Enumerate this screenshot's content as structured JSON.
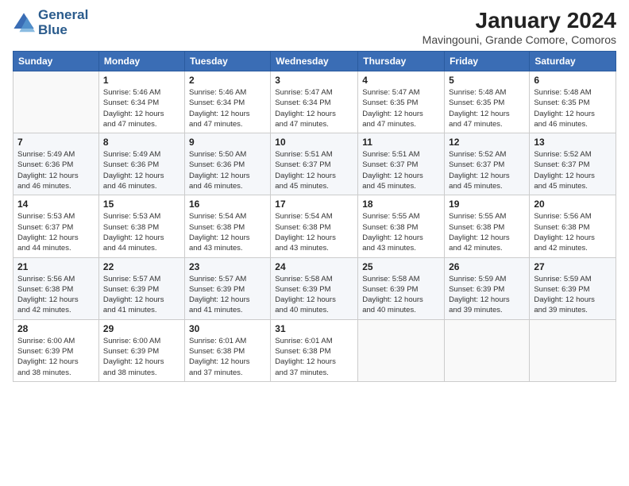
{
  "header": {
    "logo_line1": "General",
    "logo_line2": "Blue",
    "main_title": "January 2024",
    "subtitle": "Mavingouni, Grande Comore, Comoros"
  },
  "calendar": {
    "days_of_week": [
      "Sunday",
      "Monday",
      "Tuesday",
      "Wednesday",
      "Thursday",
      "Friday",
      "Saturday"
    ],
    "weeks": [
      [
        {
          "day": "",
          "info": ""
        },
        {
          "day": "1",
          "info": "Sunrise: 5:46 AM\nSunset: 6:34 PM\nDaylight: 12 hours\nand 47 minutes."
        },
        {
          "day": "2",
          "info": "Sunrise: 5:46 AM\nSunset: 6:34 PM\nDaylight: 12 hours\nand 47 minutes."
        },
        {
          "day": "3",
          "info": "Sunrise: 5:47 AM\nSunset: 6:34 PM\nDaylight: 12 hours\nand 47 minutes."
        },
        {
          "day": "4",
          "info": "Sunrise: 5:47 AM\nSunset: 6:35 PM\nDaylight: 12 hours\nand 47 minutes."
        },
        {
          "day": "5",
          "info": "Sunrise: 5:48 AM\nSunset: 6:35 PM\nDaylight: 12 hours\nand 47 minutes."
        },
        {
          "day": "6",
          "info": "Sunrise: 5:48 AM\nSunset: 6:35 PM\nDaylight: 12 hours\nand 46 minutes."
        }
      ],
      [
        {
          "day": "7",
          "info": "Sunrise: 5:49 AM\nSunset: 6:36 PM\nDaylight: 12 hours\nand 46 minutes."
        },
        {
          "day": "8",
          "info": "Sunrise: 5:49 AM\nSunset: 6:36 PM\nDaylight: 12 hours\nand 46 minutes."
        },
        {
          "day": "9",
          "info": "Sunrise: 5:50 AM\nSunset: 6:36 PM\nDaylight: 12 hours\nand 46 minutes."
        },
        {
          "day": "10",
          "info": "Sunrise: 5:51 AM\nSunset: 6:37 PM\nDaylight: 12 hours\nand 45 minutes."
        },
        {
          "day": "11",
          "info": "Sunrise: 5:51 AM\nSunset: 6:37 PM\nDaylight: 12 hours\nand 45 minutes."
        },
        {
          "day": "12",
          "info": "Sunrise: 5:52 AM\nSunset: 6:37 PM\nDaylight: 12 hours\nand 45 minutes."
        },
        {
          "day": "13",
          "info": "Sunrise: 5:52 AM\nSunset: 6:37 PM\nDaylight: 12 hours\nand 45 minutes."
        }
      ],
      [
        {
          "day": "14",
          "info": "Sunrise: 5:53 AM\nSunset: 6:37 PM\nDaylight: 12 hours\nand 44 minutes."
        },
        {
          "day": "15",
          "info": "Sunrise: 5:53 AM\nSunset: 6:38 PM\nDaylight: 12 hours\nand 44 minutes."
        },
        {
          "day": "16",
          "info": "Sunrise: 5:54 AM\nSunset: 6:38 PM\nDaylight: 12 hours\nand 43 minutes."
        },
        {
          "day": "17",
          "info": "Sunrise: 5:54 AM\nSunset: 6:38 PM\nDaylight: 12 hours\nand 43 minutes."
        },
        {
          "day": "18",
          "info": "Sunrise: 5:55 AM\nSunset: 6:38 PM\nDaylight: 12 hours\nand 43 minutes."
        },
        {
          "day": "19",
          "info": "Sunrise: 5:55 AM\nSunset: 6:38 PM\nDaylight: 12 hours\nand 42 minutes."
        },
        {
          "day": "20",
          "info": "Sunrise: 5:56 AM\nSunset: 6:38 PM\nDaylight: 12 hours\nand 42 minutes."
        }
      ],
      [
        {
          "day": "21",
          "info": "Sunrise: 5:56 AM\nSunset: 6:38 PM\nDaylight: 12 hours\nand 42 minutes."
        },
        {
          "day": "22",
          "info": "Sunrise: 5:57 AM\nSunset: 6:39 PM\nDaylight: 12 hours\nand 41 minutes."
        },
        {
          "day": "23",
          "info": "Sunrise: 5:57 AM\nSunset: 6:39 PM\nDaylight: 12 hours\nand 41 minutes."
        },
        {
          "day": "24",
          "info": "Sunrise: 5:58 AM\nSunset: 6:39 PM\nDaylight: 12 hours\nand 40 minutes."
        },
        {
          "day": "25",
          "info": "Sunrise: 5:58 AM\nSunset: 6:39 PM\nDaylight: 12 hours\nand 40 minutes."
        },
        {
          "day": "26",
          "info": "Sunrise: 5:59 AM\nSunset: 6:39 PM\nDaylight: 12 hours\nand 39 minutes."
        },
        {
          "day": "27",
          "info": "Sunrise: 5:59 AM\nSunset: 6:39 PM\nDaylight: 12 hours\nand 39 minutes."
        }
      ],
      [
        {
          "day": "28",
          "info": "Sunrise: 6:00 AM\nSunset: 6:39 PM\nDaylight: 12 hours\nand 38 minutes."
        },
        {
          "day": "29",
          "info": "Sunrise: 6:00 AM\nSunset: 6:39 PM\nDaylight: 12 hours\nand 38 minutes."
        },
        {
          "day": "30",
          "info": "Sunrise: 6:01 AM\nSunset: 6:38 PM\nDaylight: 12 hours\nand 37 minutes."
        },
        {
          "day": "31",
          "info": "Sunrise: 6:01 AM\nSunset: 6:38 PM\nDaylight: 12 hours\nand 37 minutes."
        },
        {
          "day": "",
          "info": ""
        },
        {
          "day": "",
          "info": ""
        },
        {
          "day": "",
          "info": ""
        }
      ]
    ]
  }
}
